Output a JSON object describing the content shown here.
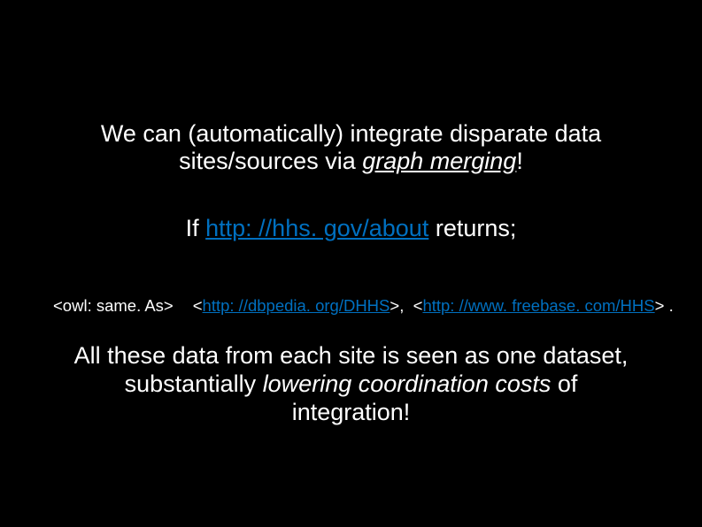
{
  "slide": {
    "para1": {
      "l1": "We can (automatically) integrate disparate data",
      "l2a": "sites/sources via ",
      "l2b": "graph merging",
      "l2c": "!"
    },
    "para2": {
      "a": "If ",
      "link": "http: //hhs. gov/about",
      "b": " returns;"
    },
    "code": {
      "owl": "<owl: same. As>",
      "l1a": "<",
      "l1b": "http: //dbpedia. org/DHHS",
      "l1c": ">,",
      "l2a": "<",
      "l2b": "http: //www. freebase. com/HHS",
      "l2c": "> ."
    },
    "para3": {
      "l1": "All these data from each site is seen as one dataset,",
      "l2a": "substantially ",
      "l2b": "lowering coordination costs",
      "l2c": " of",
      "l3": "integration!"
    }
  }
}
